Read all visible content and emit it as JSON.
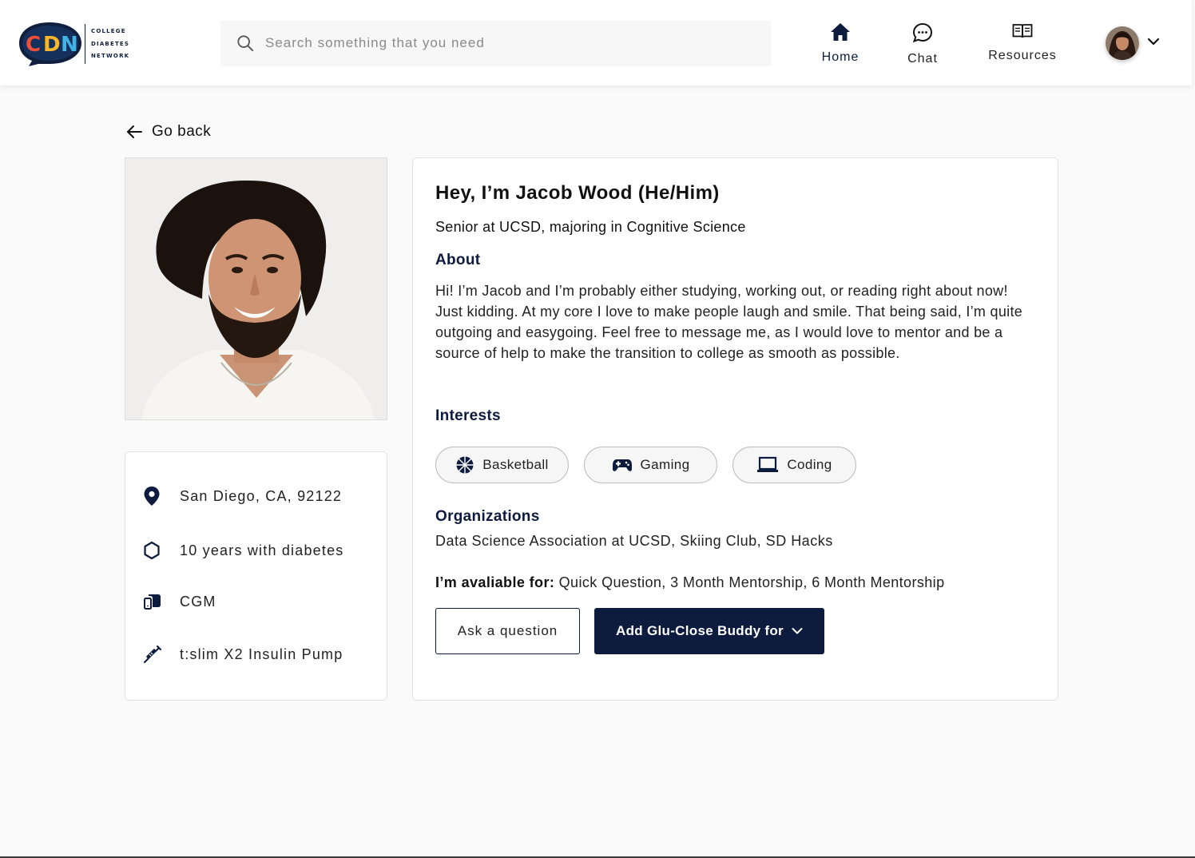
{
  "colors": {
    "navy": "#0d1b3e",
    "chip_bg": "#f6f6f6",
    "page_bg": "#fafafa"
  },
  "logo": {
    "letters": [
      "C",
      "D",
      "N"
    ],
    "words": [
      "COLLEGE",
      "DIABETES",
      "NETWORK"
    ]
  },
  "search": {
    "placeholder": "Search something that you need",
    "icon": "search-icon"
  },
  "nav": [
    {
      "label": "Home",
      "icon": "home-icon",
      "active": true
    },
    {
      "label": "Chat",
      "icon": "chat-bubble-icon",
      "active": false
    },
    {
      "label": "Resources",
      "icon": "book-open-icon",
      "active": false
    }
  ],
  "back": {
    "label": "Go back"
  },
  "facts": [
    {
      "icon": "location-pin-icon",
      "text": "San Diego, CA, 92122"
    },
    {
      "icon": "hexagon-icon",
      "text": "10 years with diabetes"
    },
    {
      "icon": "cgm-device-icon",
      "text": "CGM"
    },
    {
      "icon": "syringe-icon",
      "text": "t:slim X2 Insulin Pump"
    }
  ],
  "profile": {
    "name": "Hey, I’m Jacob Wood (He/Him)",
    "tagline": "Senior at UCSD, majoring in Cognitive Science",
    "about_title": "About",
    "about_text": "Hi! I’m Jacob and I’m probably either studying, working out, or reading right about now! Just kidding. At my core I love to make people laugh and smile. That being said, I’m quite outgoing and easygoing. Feel free to message me, as I would love to mentor and be a source of help to make the transition to college as smooth as possible.",
    "interests_title": "Interests",
    "interests": [
      {
        "label": "Basketball",
        "icon": "basketball-icon"
      },
      {
        "label": "Gaming",
        "icon": "gamepad-icon"
      },
      {
        "label": "Coding",
        "icon": "laptop-icon"
      }
    ],
    "organizations_title": "Organizations",
    "organizations": "Data Science Association at UCSD, Skiing Club, SD Hacks",
    "available_label": "I’m avaliable for:",
    "available_value": "Quick Question, 3 Month Mentorship, 6 Month Mentorship"
  },
  "actions": {
    "ask": "Ask a question",
    "add": "Add Glu-Close Buddy for"
  }
}
